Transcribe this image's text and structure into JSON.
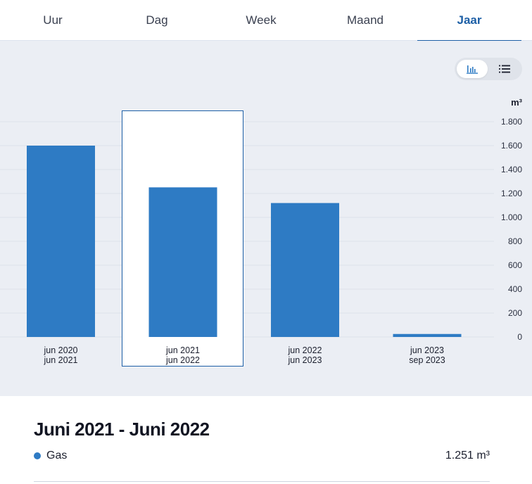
{
  "tabs": [
    {
      "label": "Uur",
      "active": false
    },
    {
      "label": "Dag",
      "active": false
    },
    {
      "label": "Week",
      "active": false
    },
    {
      "label": "Maand",
      "active": false
    },
    {
      "label": "Jaar",
      "active": true
    }
  ],
  "view_toggle": {
    "options": [
      {
        "name": "chart-view",
        "icon": "bar-chart-icon",
        "selected": true
      },
      {
        "name": "list-view",
        "icon": "list-icon",
        "selected": false
      }
    ]
  },
  "colors": {
    "bar": "#2e7bc4",
    "accent": "#1d5fa6",
    "selection_border": "#1d5fa6",
    "grid": "#dce1ea",
    "panel_bg": "#ebeef4"
  },
  "chart_data": {
    "type": "bar",
    "unit": "m³",
    "categories": [
      [
        "jun 2020",
        "jun 2021"
      ],
      [
        "jun 2021",
        "jun 2022"
      ],
      [
        "jun 2022",
        "jun 2023"
      ],
      [
        "jun 2023",
        "sep 2023"
      ]
    ],
    "series": [
      {
        "name": "Gas",
        "values": [
          1600,
          1251,
          1120,
          25
        ]
      }
    ],
    "y_ticks": [
      "0",
      "200",
      "400",
      "600",
      "800",
      "1.000",
      "1.200",
      "1.400",
      "1.600",
      "1.800"
    ],
    "ylim": [
      0,
      1800
    ],
    "y_axis_position": "right",
    "grid": true,
    "selected_index": 1
  },
  "detail": {
    "title": "Juni 2021 - Juni 2022",
    "legend_label": "Gas",
    "legend_value": "1.251 m³"
  }
}
